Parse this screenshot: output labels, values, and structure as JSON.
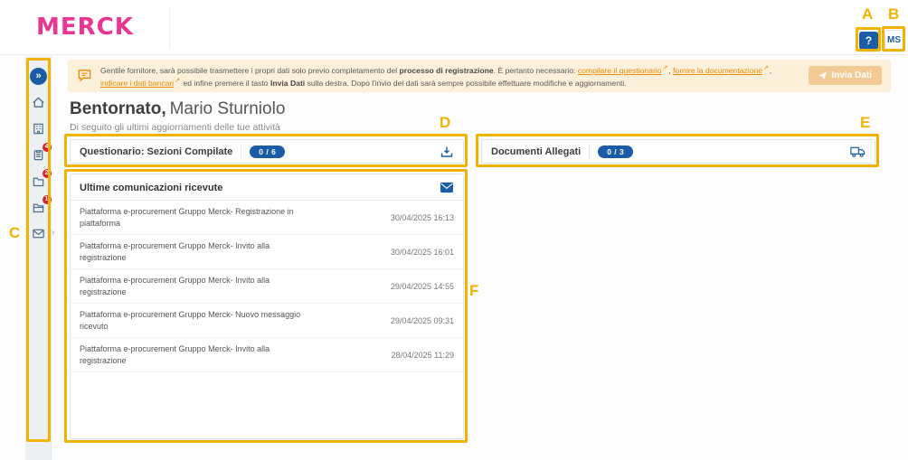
{
  "header": {
    "logo": "MERCK",
    "help_label": "?",
    "avatar_initials": "MS"
  },
  "sidebar": {
    "expand_glyph": "»",
    "messages_chevron": "›",
    "items": [
      {
        "name": "home"
      },
      {
        "name": "company"
      },
      {
        "name": "questionnaire",
        "badge": "4"
      },
      {
        "name": "documents",
        "badge": "2"
      },
      {
        "name": "bank-data",
        "badge": "1"
      },
      {
        "name": "messages"
      }
    ]
  },
  "banner": {
    "intro": "Gentile fornitore, sarà possibile trasmettere i propri dati solo previo completamento del ",
    "bold1": "processo di registrazione",
    "mid1": ". È pertanto necessario: ",
    "link1": "compilare il questionario",
    "sep1": ", ",
    "link2": "fornire la documentazione",
    "sep2": ", ",
    "link3": "indicare i dati bancari",
    "mid2": " ed infine premere il tasto ",
    "bold2": "Invia Dati",
    "end": " sulla destra. Dopo l'invio dei dati sarà sempre possibile effettuare modifiche e aggiornamenti.",
    "external_glyph": "↗",
    "submit_button": "Invia Dati"
  },
  "welcome": {
    "greeting": "Bentornato,",
    "name": "Mario Sturniolo",
    "subtitle": "Di seguito gli ultimi aggiornamenti delle tue attività"
  },
  "cards": {
    "questionnaire": {
      "title": "Questionario: Sezioni Compilate",
      "badge": "0 / 6"
    },
    "documents": {
      "title": "Documenti Allegati",
      "badge": "0 / 3"
    }
  },
  "communications": {
    "title": "Ultime comunicazioni ricevute",
    "items": [
      {
        "subject": "Piattaforma e-procurement Gruppo Merck- Registrazione in piattaforma",
        "date": "30/04/2025 16:13"
      },
      {
        "subject": "Piattaforma e-procurement Gruppo Merck- Invito alla registrazione",
        "date": "30/04/2025 16:01"
      },
      {
        "subject": "Piattaforma e-procurement Gruppo Merck- Invito alla registrazione",
        "date": "29/04/2025 14:55"
      },
      {
        "subject": "Piattaforma e-procurement Gruppo Merck- Nuovo messaggio ricevuto",
        "date": "29/04/2025 09:31"
      },
      {
        "subject": "Piattaforma e-procurement Gruppo Merck- Invito alla registrazione",
        "date": "28/04/2025 11:29"
      }
    ]
  },
  "annotations": {
    "color": "#F2B200",
    "labels": {
      "a": "A",
      "b": "B",
      "c": "C",
      "d": "D",
      "e": "E",
      "f": "F"
    }
  },
  "colors": {
    "brand_pink": "#EA3592",
    "primary_blue": "#1A5DA6",
    "banner_bg": "#FCF0DB",
    "link_orange": "#ED8B00",
    "badge_red": "#D9232E",
    "annotation_gold": "#F2B200"
  }
}
